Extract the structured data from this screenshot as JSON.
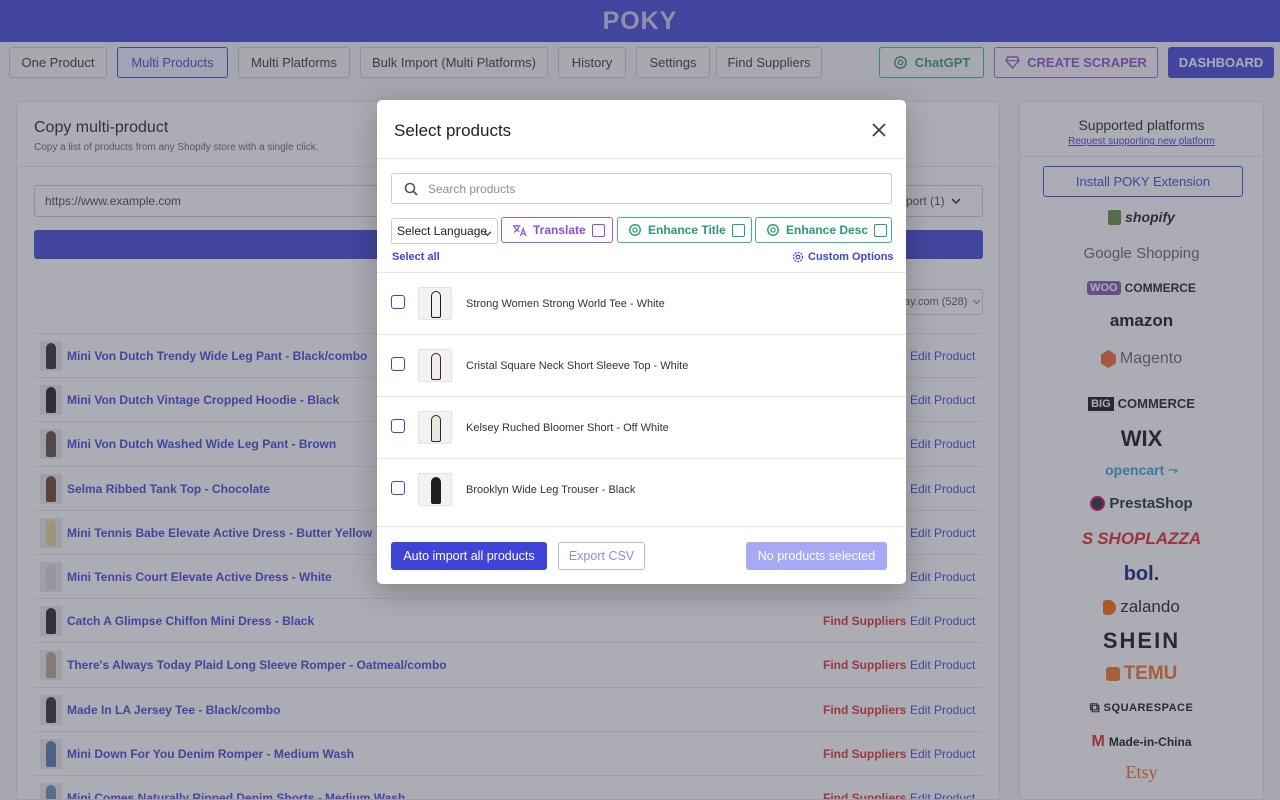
{
  "app": {
    "logo": "POKY"
  },
  "nav": {
    "tabs": [
      {
        "label": "One Product"
      },
      {
        "label": "Multi Products",
        "active": true
      },
      {
        "label": "Multi Platforms"
      },
      {
        "label": "Bulk Import (Multi Platforms)"
      },
      {
        "label": "History"
      },
      {
        "label": "Settings"
      },
      {
        "label": "Find Suppliers"
      }
    ],
    "chatgpt_label": "ChatGPT",
    "scraper_label": "CREATE SCRAPER",
    "dashboard_label": "DASHBOARD"
  },
  "main": {
    "title": "Copy multi-product",
    "subtitle": "Copy a list of products from any Shopify store with a single click.",
    "url_placeholder": "https://www.example.com",
    "import_select": "port (1)",
    "store_select": "ay.com (528)",
    "find_suppliers_label": "Find Suppliers",
    "edit_product_label": "Edit Product",
    "rows": [
      {
        "name": "Mini Von Dutch Trendy Wide Leg Pant - Black/combo",
        "swatch": "#2a2a2a",
        "find": false
      },
      {
        "name": "Mini Von Dutch Vintage Cropped Hoodie - Black",
        "swatch": "#1c1c1c",
        "find": false
      },
      {
        "name": "Mini Von Dutch Washed Wide Leg Pant - Brown",
        "swatch": "#5a4a3e",
        "find": false
      },
      {
        "name": "Selma Ribbed Tank Top - Chocolate",
        "swatch": "#6b3f2a",
        "find": false
      },
      {
        "name": "Mini Tennis Babe Elevate Active Dress - Butter Yellow",
        "swatch": "#e6d88c",
        "find": false
      },
      {
        "name": "Mini Tennis Court Elevate Active Dress - White",
        "swatch": "#d8d8d8",
        "find": false
      },
      {
        "name": "Catch A Glimpse Chiffon Mini Dress - Black",
        "swatch": "#222222",
        "find": true
      },
      {
        "name": "There's Always Today Plaid Long Sleeve Romper - Oatmeal/combo",
        "swatch": "#b9a58e",
        "find": true
      },
      {
        "name": "Made In LA Jersey Tee - Black/combo",
        "swatch": "#2b2b2b",
        "find": true
      },
      {
        "name": "Mini Down For You Denim Romper - Medium Wash",
        "swatch": "#4f78a8",
        "find": true
      },
      {
        "name": "Mini Comes Naturally Ripped Denim Shorts - Medium Wash",
        "swatch": "#6d8fb8",
        "find": true
      }
    ]
  },
  "sidebar": {
    "title": "Supported platforms",
    "request_link": "Request supporting new platform",
    "install_button": "Install POKY Extension",
    "platforms": [
      {
        "name": "shopify",
        "color": "#1a1a1a"
      },
      {
        "name": "Google Shopping",
        "color": "#5f6368"
      },
      {
        "name": "COMMERCE",
        "color": "#1a1a1a"
      },
      {
        "name": "amazon",
        "color": "#111111"
      },
      {
        "name": "Magento",
        "color": "#666666"
      },
      {
        "name": "COMMERCE",
        "color": "#1a1a1a"
      },
      {
        "name": "WIX",
        "color": "#111111"
      },
      {
        "name": "opencart",
        "color": "#2aa6d8"
      },
      {
        "name": "PrestaShop",
        "color": "#1d2a3a"
      },
      {
        "name": "SHOPLAZZA",
        "color": "#e0262b"
      },
      {
        "name": "bol.",
        "color": "#0a1e7a"
      },
      {
        "name": "zalando",
        "color": "#1a1a1a"
      },
      {
        "name": "SHEIN",
        "color": "#111111"
      },
      {
        "name": "TEMU",
        "color": "#f47424"
      },
      {
        "name": "SQUARESPACE",
        "color": "#111111"
      },
      {
        "name": "Made-in-China",
        "color": "#111111"
      },
      {
        "name": "Etsy",
        "color": "#f1641e"
      }
    ]
  },
  "modal": {
    "title": "Select products",
    "search_placeholder": "Search products",
    "language_select": "Select Language",
    "translate_label": "Translate",
    "enhance_title_label": "Enhance Title",
    "enhance_desc_label": "Enhance Desc",
    "select_all": "Select all",
    "custom_options": "Custom Options",
    "products": [
      {
        "name": "Strong Women Strong World Tee - White",
        "swatch": "#f2f2f2",
        "accent": "#1b1b1b"
      },
      {
        "name": "Cristal Square Neck Short Sleeve Top - White",
        "swatch": "#f0ece8",
        "accent": "#3a2a20"
      },
      {
        "name": "Kelsey Ruched Bloomer Short - Off White",
        "swatch": "#ece7de",
        "accent": "#2a2a2a"
      },
      {
        "name": "Brooklyn Wide Leg Trouser - Black",
        "swatch": "#1e1e1e",
        "accent": "#1e1e1e"
      }
    ],
    "auto_import_label": "Auto import all products",
    "export_csv_label": "Export CSV",
    "selected_status": "No products selected"
  },
  "colors": {
    "primary": "#3e44d7",
    "danger": "#e02d2d",
    "chatgpt": "#3eb58e",
    "scraper": "#9b5de5"
  }
}
